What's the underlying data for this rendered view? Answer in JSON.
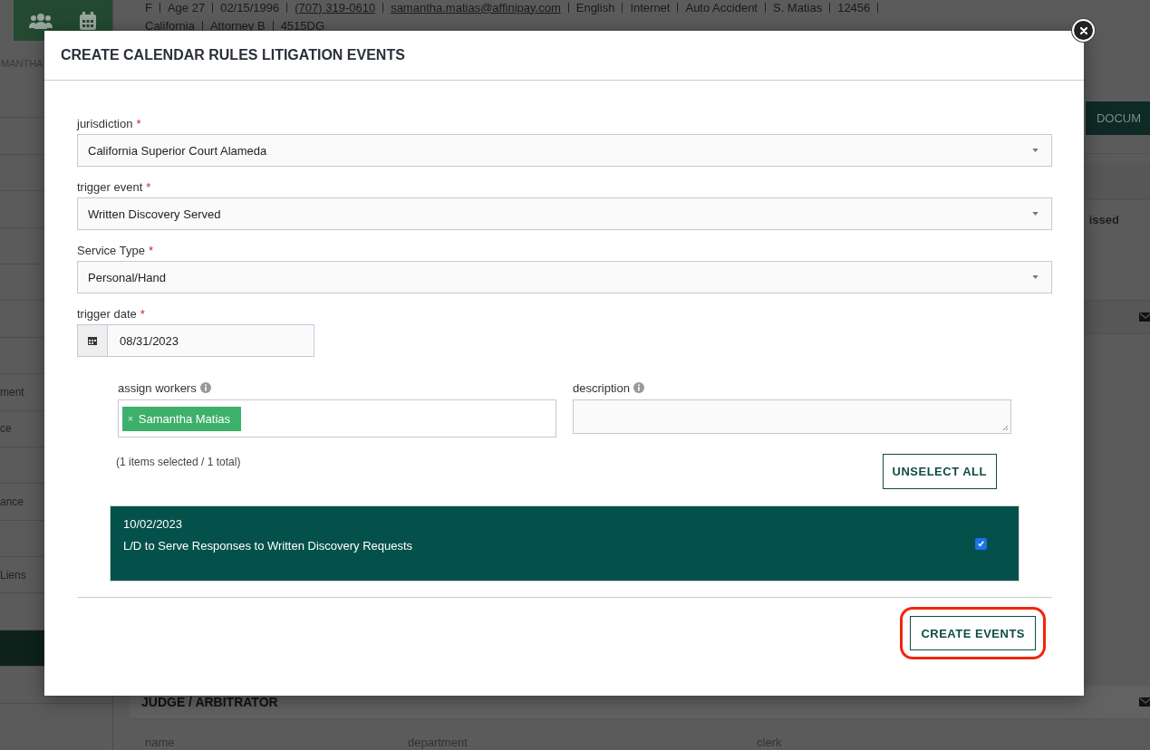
{
  "background_page": {
    "header_line_1": [
      {
        "text": "F",
        "link": false
      },
      {
        "text": "Age 27",
        "link": false
      },
      {
        "text": "02/15/1996",
        "link": false
      },
      {
        "text": "(707) 319-0610",
        "link": true
      },
      {
        "text": "samantha.matias@affinipay.com",
        "link": true
      },
      {
        "text": "English",
        "link": false
      },
      {
        "text": "Internet",
        "link": false
      },
      {
        "text": "Auto Accident",
        "link": false
      },
      {
        "text": "S. Matias",
        "link": false
      },
      {
        "text": "12456",
        "link": false
      }
    ],
    "header_line_2": [
      "California",
      "Attorney B",
      "4515DG"
    ],
    "sidebar_name": "MANTHA",
    "sidebar_items": [
      "ment",
      "ce",
      "ance",
      "Liens"
    ],
    "documents_button": "DOCUM",
    "status_text": "issed",
    "judge_section_title": "JUDGE / ARBITRATOR",
    "judge_columns": [
      "name",
      "department",
      "clerk"
    ]
  },
  "modal": {
    "title": "CREATE CALENDAR RULES LITIGATION EVENTS",
    "fields": [
      {
        "label": "jurisdiction",
        "required_mark": "*",
        "value": "California Superior Court Alameda"
      },
      {
        "label": "trigger event",
        "required_mark": "*",
        "value": "Written Discovery Served"
      },
      {
        "label": "Service Type",
        "required_mark": "*",
        "value": "Personal/Hand"
      }
    ],
    "trigger_date": {
      "label": "trigger date",
      "required_mark": "*",
      "value": "08/31/2023"
    },
    "assign_workers": {
      "label": "assign workers",
      "tags": [
        {
          "remove": "×",
          "name": "Samantha Matias"
        }
      ]
    },
    "description": {
      "label": "description"
    },
    "selection_summary": "(1 items selected / 1 total)",
    "unselect_button": "UNSELECT ALL",
    "events": [
      {
        "date": "10/02/2023",
        "title": "L/D to Serve Responses to Written Discovery Requests",
        "checked": true
      }
    ],
    "create_button": "CREATE EVENTS"
  }
}
